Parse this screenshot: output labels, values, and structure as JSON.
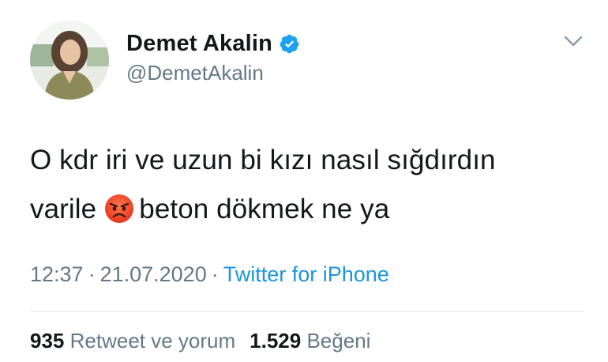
{
  "user": {
    "display_name": "Demet Akalin",
    "handle": "@DemetAkalin",
    "verified": true
  },
  "icons": {
    "verified": "verified-badge-icon",
    "menu": "chevron-down-icon",
    "emoji": "angry-face-emoji"
  },
  "tweet": {
    "line1": "O kdr iri ve uzun bi kızı nasıl sığdırdın",
    "line2_before": "varile",
    "line2_after": "beton dökmek ne ya"
  },
  "meta": {
    "time": "12:37",
    "separator": "·",
    "date": "21.07.2020",
    "source": "Twitter for iPhone"
  },
  "stats": {
    "retweets_count": "935",
    "retweets_label": "Retweet ve yorum",
    "likes_count": "1.529",
    "likes_label": "Beğeni"
  },
  "colors": {
    "text": "#14171a",
    "secondary": "#657786",
    "link": "#1b95e0",
    "verified": "#1da1f2",
    "divider": "#dfe4e8"
  }
}
